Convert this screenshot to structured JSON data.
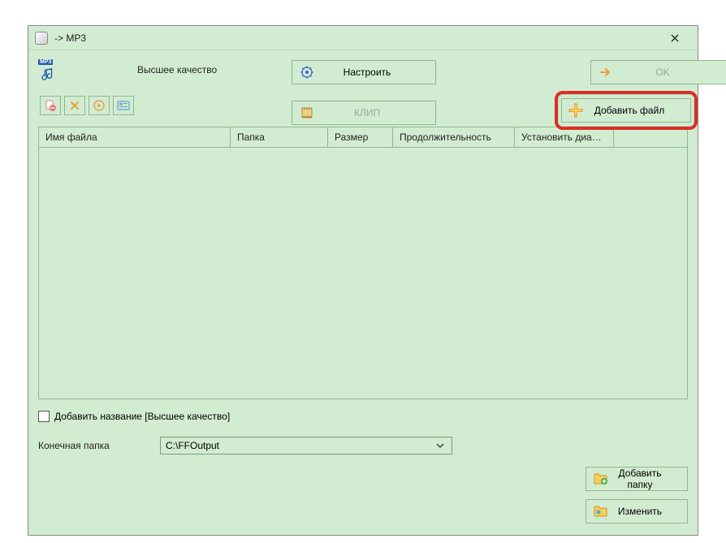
{
  "window": {
    "title": "-> MP3"
  },
  "top": {
    "quality_label": "Высшее качество",
    "configure_label": "Настроить",
    "ok_label": "OK",
    "clip_label": "КЛИП",
    "add_file_label": "Добавить файл"
  },
  "table": {
    "headers": {
      "filename": "Имя файла",
      "folder": "Папка",
      "size": "Размер",
      "duration": "Продолжительность",
      "range": "Установить диапа..."
    },
    "rows": []
  },
  "bottom": {
    "add_title_checkbox_label": "Добавить название [Высшее качество]",
    "add_title_checked": false,
    "output_folder_label": "Конечная папка",
    "output_folder_value": "C:\\FFOutput",
    "add_folder_label": "Добавить папку",
    "change_label": "Изменить"
  }
}
